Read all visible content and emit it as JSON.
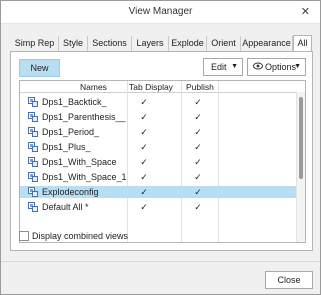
{
  "window": {
    "title": "View Manager",
    "close_glyph": "✕"
  },
  "tabs": [
    {
      "label": "Simp Rep"
    },
    {
      "label": "Style"
    },
    {
      "label": "Sections"
    },
    {
      "label": "Layers"
    },
    {
      "label": "Explode"
    },
    {
      "label": "Orient"
    },
    {
      "label": "Appearance"
    },
    {
      "label": "All",
      "active": true
    }
  ],
  "toolbar": {
    "new_label": "New",
    "edit_label": "Edit",
    "options_label": "Options",
    "caret": "▼",
    "eye_icon": "👁"
  },
  "table": {
    "headers": {
      "names": "Names",
      "tab_display": "Tab Display",
      "publish": "Publish"
    },
    "check_glyph": "✓",
    "rows": [
      {
        "name": "Dps1_Backtick_",
        "tab_display": true,
        "publish": true
      },
      {
        "name": "Dps1_Parenthesis__",
        "tab_display": true,
        "publish": true
      },
      {
        "name": "Dps1_Period_",
        "tab_display": true,
        "publish": true
      },
      {
        "name": "Dps1_Plus_",
        "tab_display": true,
        "publish": true
      },
      {
        "name": "Dps1_With_Space",
        "tab_display": true,
        "publish": true
      },
      {
        "name": "Dps1_With_Space_1",
        "tab_display": true,
        "publish": true
      },
      {
        "name": "Explodeconfig",
        "tab_display": true,
        "publish": true,
        "selected": true
      },
      {
        "name": "Default All *",
        "tab_display": true,
        "publish": true
      }
    ]
  },
  "combined_views": {
    "label": "Display combined views",
    "checked": false
  },
  "footer": {
    "close_label": "Close"
  },
  "colors": {
    "selection": "#b8def4",
    "accent_button": "#b8def4"
  }
}
